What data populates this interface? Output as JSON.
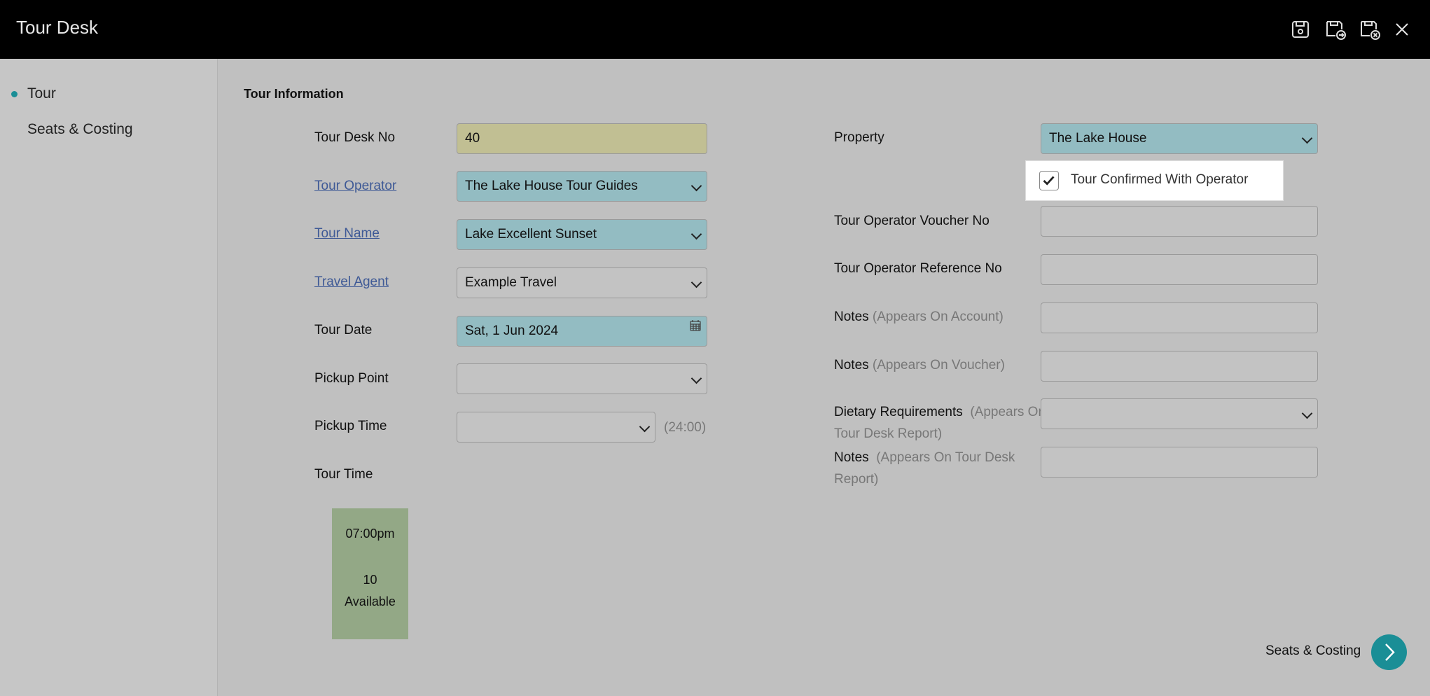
{
  "window": {
    "title": "Tour Desk"
  },
  "header": {
    "icons": [
      "save-icon",
      "save-and-new-icon",
      "save-and-close-icon",
      "close-icon"
    ]
  },
  "sidebar": {
    "items": [
      {
        "label": "Tour",
        "active": true
      },
      {
        "label": "Seats & Costing",
        "active": false
      }
    ]
  },
  "section": {
    "title": "Tour Information"
  },
  "left": {
    "tour_desk_no": {
      "label": "Tour Desk No",
      "value": "40"
    },
    "tour_operator": {
      "label": "Tour Operator",
      "value": "The Lake House Tour Guides"
    },
    "tour_name": {
      "label": "Tour Name",
      "value": "Lake Excellent Sunset"
    },
    "travel_agent": {
      "label": "Travel Agent",
      "value": "Example Travel"
    },
    "tour_date": {
      "label": "Tour Date",
      "value": "Sat, 1 Jun 2024"
    },
    "pickup_point": {
      "label": "Pickup Point",
      "value": ""
    },
    "pickup_time": {
      "label": "Pickup Time",
      "value": "",
      "hint": "(24:00)"
    },
    "tour_time": {
      "label": "Tour Time",
      "slot": {
        "time": "07:00pm",
        "count": "10",
        "status": "Available"
      }
    }
  },
  "right": {
    "property": {
      "label": "Property",
      "value": "The Lake House"
    },
    "confirmed": {
      "label": "Tour Confirmed With Operator",
      "checked": true
    },
    "voucher_no": {
      "label": "Tour Operator Voucher No",
      "value": ""
    },
    "reference_no": {
      "label": "Tour Operator Reference No",
      "value": ""
    },
    "notes_account": {
      "label": "Notes",
      "hint": "(Appears On Account)",
      "value": ""
    },
    "notes_voucher": {
      "label": "Notes",
      "hint": "(Appears On Voucher)",
      "value": ""
    },
    "dietary": {
      "label": "Dietary Requirements",
      "hint1": "(Appears On",
      "hint2": "Tour Desk Report)",
      "value": ""
    },
    "notes_report": {
      "label": "Notes",
      "hint1": "(Appears On Tour Desk",
      "hint2": "Report)",
      "value": ""
    }
  },
  "footer": {
    "next_label": "Seats & Costing"
  },
  "colors": {
    "accent": "#1a8e96",
    "mandatory_field": "#93bcc2",
    "readonly_field": "#c1bf93",
    "slot": "#93a886"
  }
}
